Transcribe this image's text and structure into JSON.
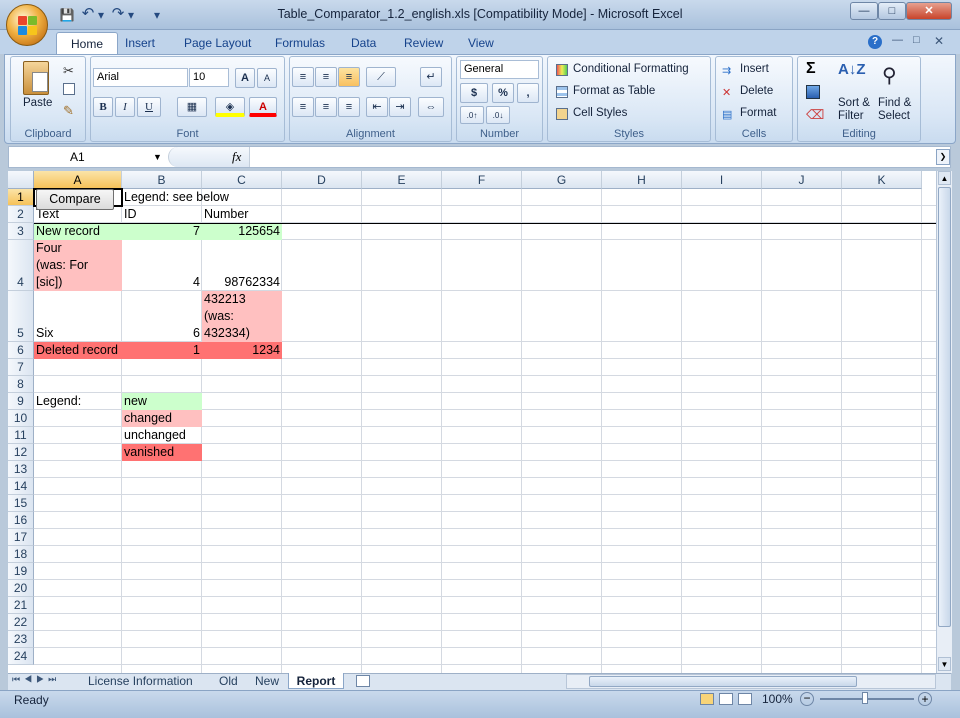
{
  "window": {
    "title": "Table_Comparator_1.2_english.xls  [Compatibility Mode] - Microsoft Excel"
  },
  "qat": {
    "save": "💾",
    "undo": "↶",
    "redo": "↷",
    "customize": "▾"
  },
  "winbuttons": {
    "minimize": "—",
    "maximize": "□",
    "close": "✕"
  },
  "tabs": [
    "Home",
    "Insert",
    "Page Layout",
    "Formulas",
    "Data",
    "Review",
    "View"
  ],
  "ribbon": {
    "clipboard": {
      "label": "Clipboard",
      "paste": "Paste"
    },
    "font": {
      "label": "Font",
      "name": "Arial",
      "size": "10",
      "bold": "B",
      "italic": "I",
      "underline": "U",
      "grow": "A",
      "shrink": "A"
    },
    "alignment": {
      "label": "Alignment"
    },
    "number": {
      "label": "Number",
      "format": "General",
      "currency": "$",
      "percent": "%",
      "comma": ","
    },
    "styles": {
      "label": "Styles",
      "conditional": "Conditional Formatting",
      "table": "Format as Table",
      "cell": "Cell Styles"
    },
    "cells": {
      "label": "Cells",
      "insert": "Insert",
      "delete": "Delete",
      "format": "Format"
    },
    "editing": {
      "label": "Editing",
      "sort": "Sort &",
      "sort2": "Filter",
      "find": "Find &",
      "find2": "Select",
      "sigma": "Σ"
    }
  },
  "formula_bar": {
    "name_box": "A1",
    "fx": "fx",
    "value": ""
  },
  "columns": [
    "A",
    "B",
    "C",
    "D",
    "E",
    "F",
    "G",
    "H",
    "I",
    "J",
    "K"
  ],
  "rows": [
    "1",
    "2",
    "3",
    "4",
    "5",
    "6",
    "7",
    "8",
    "9",
    "10",
    "11",
    "12",
    "13",
    "14",
    "15",
    "16",
    "17",
    "18",
    "19",
    "20",
    "21",
    "22",
    "23",
    "24"
  ],
  "cells": {
    "compare_button": "Compare",
    "B1": "Legend: see below",
    "A2": "Text",
    "B2": "ID",
    "C2": "Number",
    "A3": "New record",
    "B3": "7",
    "C3": "125654",
    "A4": "Four\n(was: For\n[sic])",
    "B4": "4",
    "C4": "98762334",
    "A5": "Six",
    "B5": "6",
    "C5": "432213\n(was:\n432334)",
    "A6": "Deleted record",
    "B6": "1",
    "C6": "1234",
    "A9": "Legend:",
    "B9": "new",
    "B10": "changed",
    "B11": "unchanged",
    "B12": "vanished"
  },
  "colors": {
    "new": "#ccffcc",
    "changed": "#ffc0c0",
    "vanished": "#ff7272",
    "accent": "#15428b"
  },
  "sheets": [
    "License Information",
    "Old",
    "New",
    "Report"
  ],
  "active_sheet": "Report",
  "status": {
    "ready": "Ready",
    "zoom": "100%"
  }
}
